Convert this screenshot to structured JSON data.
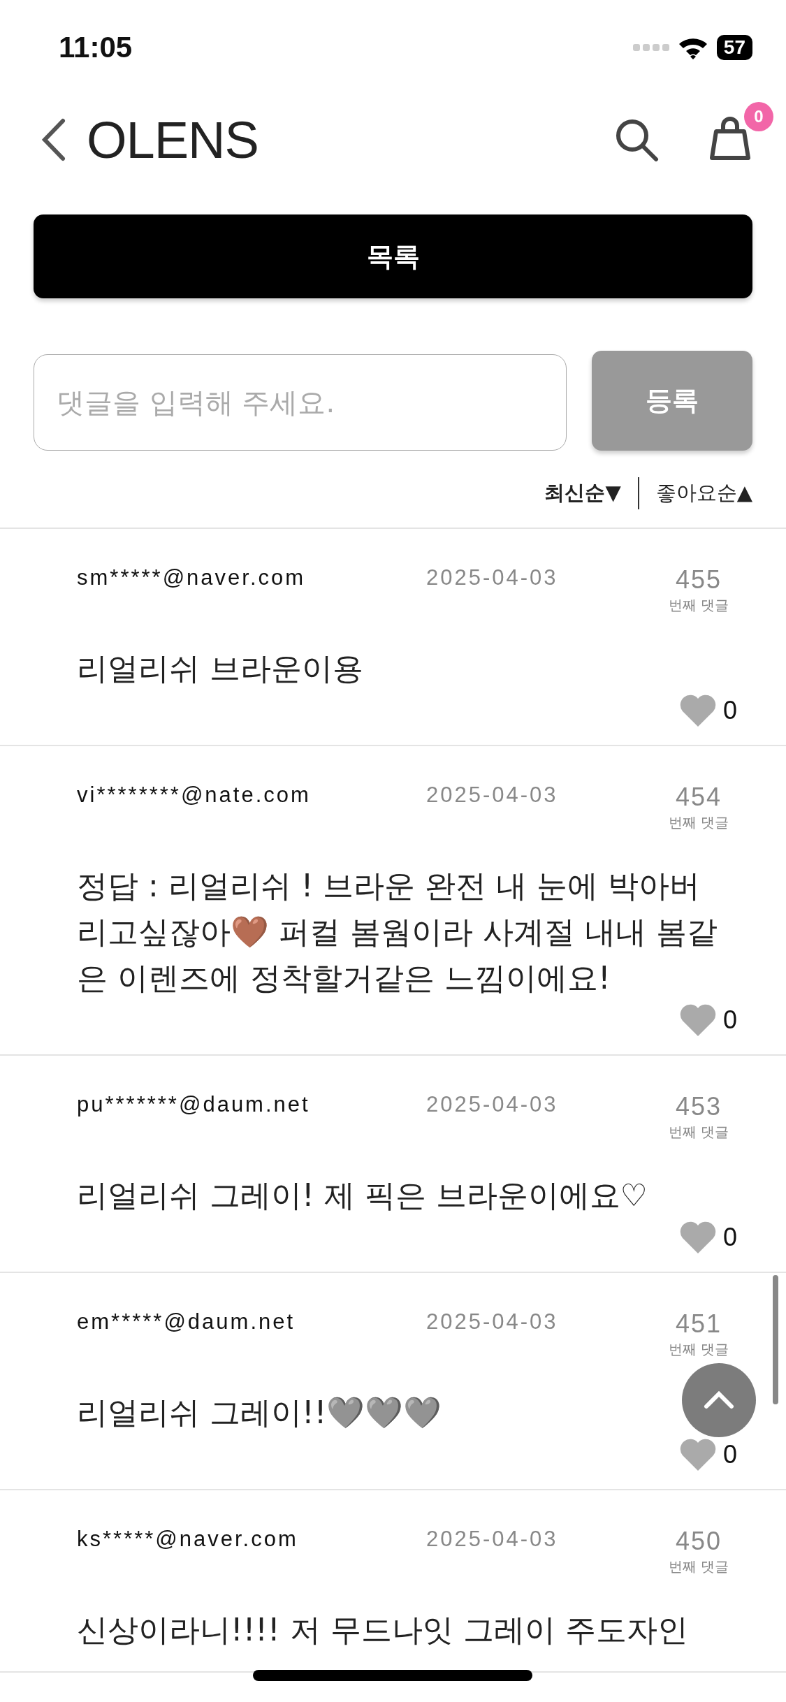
{
  "status_bar": {
    "time": "11:05",
    "battery": "57"
  },
  "header": {
    "logo": "OLENS",
    "cart_count": "0"
  },
  "list_button": "목록",
  "comment_form": {
    "placeholder": "댓글을 입력해 주세요.",
    "submit": "등록"
  },
  "sort_options": [
    {
      "label": "최신순▼",
      "selected": true
    },
    {
      "label": "좋아요순▲",
      "selected": false
    }
  ],
  "comments": [
    {
      "author": "sm*****@naver.com",
      "date": "2025-04-03",
      "number": "455",
      "number_label": "번째 댓글",
      "text": "리얼리쉬 브라운이용",
      "likes": "0"
    },
    {
      "author": "vi********@nate.com",
      "date": "2025-04-03",
      "number": "454",
      "number_label": "번째 댓글",
      "text": "정답 : 리얼리쉬 ! 브라운 완전 내 눈에 박아버리고싶잖아🤎 퍼컬 봄웜이라 사계절 내내 봄같은 이렌즈에 정착할거같은 느낌이에요!",
      "likes": "0"
    },
    {
      "author": "pu*******@daum.net",
      "date": "2025-04-03",
      "number": "453",
      "number_label": "번째 댓글",
      "text": "리얼리쉬 그레이! 제 픽은 브라운이에요♡",
      "likes": "0"
    },
    {
      "author": "em*****@daum.net",
      "date": "2025-04-03",
      "number": "451",
      "number_label": "번째 댓글",
      "text": "리얼리쉬 그레이!!🩶🩶🩶",
      "likes": "0"
    },
    {
      "author": "ks*****@naver.com",
      "date": "2025-04-03",
      "number": "450",
      "number_label": "번째 댓글",
      "text": "신상이라니!!!! 저 무드나잇 그레이 주도자인"
    }
  ]
}
